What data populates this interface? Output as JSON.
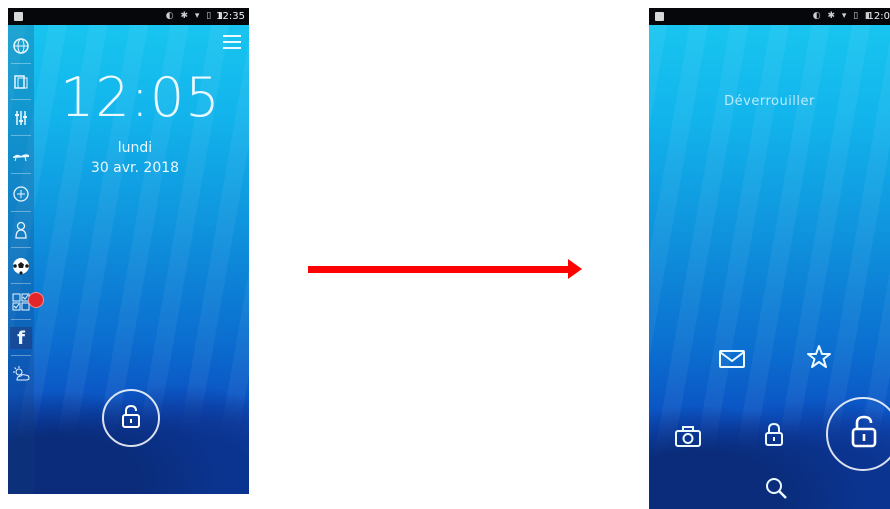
{
  "left_screen": {
    "status_time": "12:35",
    "clock": "12:05",
    "day": "lundi",
    "date": "30 avr. 2018",
    "sidebar_icons": [
      "globe-icon",
      "book-icon",
      "equalizer-icon",
      "horse-icon",
      "compass-icon",
      "character-icon",
      "soccer-ball-icon",
      "checklist-icon",
      "facebook-icon",
      "weather-icon"
    ],
    "facebook_letter": "f",
    "badge_color": "#e3262b"
  },
  "right_screen": {
    "status_time": "12:0",
    "unlock_label": "Déverrouiller",
    "shortcut_icons": [
      "mail-icon",
      "star-icon",
      "camera-icon",
      "lock-icon",
      "search-icon",
      "unlock-icon"
    ]
  },
  "arrow": {
    "color": "#ff0000"
  }
}
